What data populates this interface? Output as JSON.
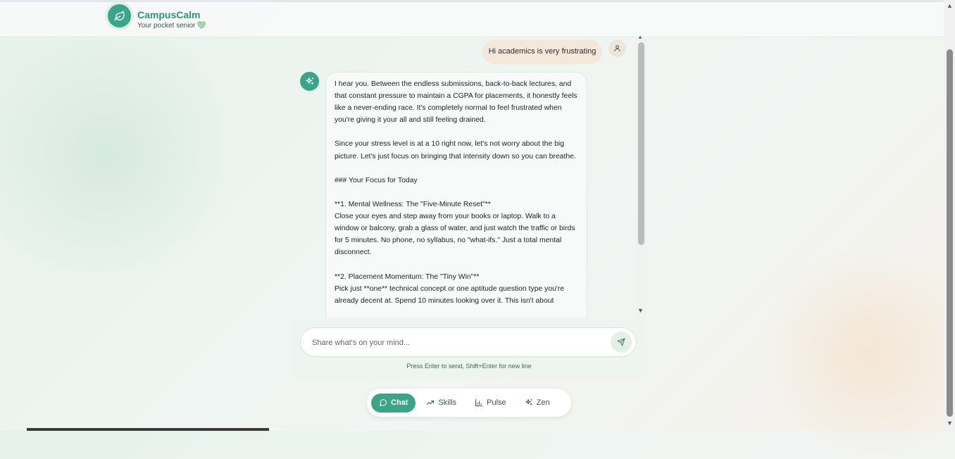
{
  "app": {
    "title": "CampusCalm",
    "subtitle": "Your pocket senior",
    "brand_color": "#3aa588",
    "heart_icon": "heart-icon"
  },
  "chat": {
    "user_message": "Hi academics is very frustrating",
    "bot_paragraphs": [
      "I hear you. Between the endless submissions, back-to-back lectures, and that constant pressure to maintain a CGPA for placements, it honestly feels like a never-ending race. It's completely normal to feel frustrated when you're giving it your all and still feeling drained.",
      "",
      "Since your stress level is at a 10 right now, let's not worry about the big picture. Let's just focus on bringing that intensity down so you can breathe.",
      "",
      "### Your Focus for Today",
      "",
      "**1. Mental Wellness: The \"Five-Minute Reset\"**",
      "Close your eyes and step away from your books or laptop. Walk to a window or balcony, grab a glass of water, and just watch the traffic or birds for 5 minutes. No phone, no syllabus, no \"what-ifs.\" Just a total mental disconnect.",
      "",
      "**2. Placement Momentum: The \"Tiny Win\"**",
      "Pick just **one** technical concept or one aptitude question type you're already decent at. Spend 10 minutes looking over it. This isn't about"
    ]
  },
  "composer": {
    "placeholder": "Share what's on your mind...",
    "hint": "Press Enter to send, Shift+Enter for new line"
  },
  "nav": {
    "items": [
      {
        "label": "Chat",
        "icon": "chat-bubble-icon",
        "active": true
      },
      {
        "label": "Skills",
        "icon": "trend-up-icon",
        "active": false
      },
      {
        "label": "Pulse",
        "icon": "bar-chart-icon",
        "active": false
      },
      {
        "label": "Zen",
        "icon": "sparkle-icon",
        "active": false
      }
    ]
  }
}
